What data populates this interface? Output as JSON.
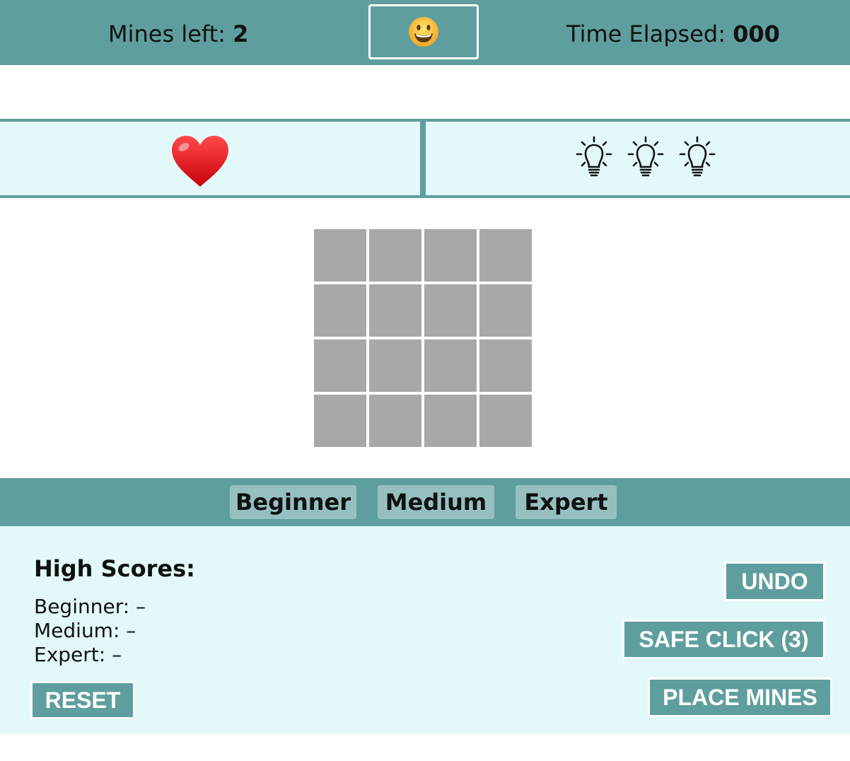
{
  "header": {
    "mines_left_label": "Mines left:",
    "mines_left_value": "2",
    "smiley_icon": "grinning-face-emoji",
    "time_label": "Time Elapsed:",
    "time_value": "000"
  },
  "status": {
    "lives": 1,
    "lives_icon": "red-heart-icon",
    "hints": 3,
    "hint_icon": "lightbulb-icon"
  },
  "board": {
    "rows": 4,
    "cols": 4,
    "cell_state": "unrevealed"
  },
  "levels": [
    "Beginner",
    "Medium",
    "Expert"
  ],
  "high_scores": {
    "title": "High Scores:",
    "beginner": "Beginner: –",
    "medium": "Medium: –",
    "expert": "Expert: –"
  },
  "buttons": {
    "undo": "UNDO",
    "safe_click": "SAFE CLICK (3)",
    "place_mines": "PLACE MINES",
    "reset": "RESET"
  },
  "colors": {
    "bar": "#5f9e9e",
    "panel": "#e3f8f8",
    "level_button": "#96c0c0",
    "cell": "#a8a8a8"
  }
}
